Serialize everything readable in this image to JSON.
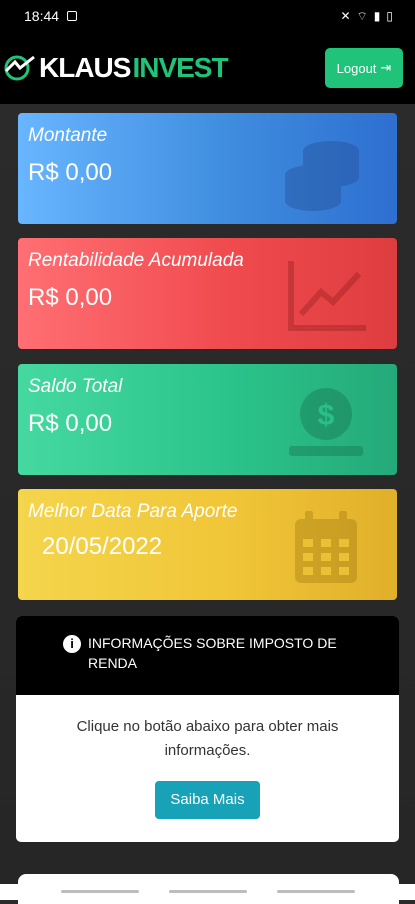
{
  "status_bar": {
    "time": "18:44",
    "icons": [
      "notification-icon",
      "mute-icon",
      "wifi-icon",
      "signal-icon",
      "battery-icon"
    ]
  },
  "header": {
    "brand": {
      "part1": "KLAUS",
      "part2": "INVEST",
      "accent": "#1fc47a"
    },
    "logout_label": "Logout"
  },
  "cards": [
    {
      "label": "Montante",
      "value": "R$ 0,00",
      "icon": "coins-icon",
      "color": "#3f8ddf"
    },
    {
      "label": "Rentabilidade Acumulada",
      "value": "R$ 0,00",
      "icon": "chart-line-icon",
      "color": "#f04b4f"
    },
    {
      "label": "Saldo Total",
      "value": "R$ 0,00",
      "icon": "dollar-coin-icon",
      "color": "#2bc48b"
    },
    {
      "label": "Melhor Data Para Aporte",
      "value": "20/05/2022",
      "icon": "calendar-icon",
      "color": "#f1c638"
    }
  ],
  "info_panel": {
    "title": "INFORMAÇÕES SOBRE IMPOSTO DE RENDA",
    "text": "Clique no botão abaixo para obter mais informações.",
    "button": "Saiba Mais"
  }
}
